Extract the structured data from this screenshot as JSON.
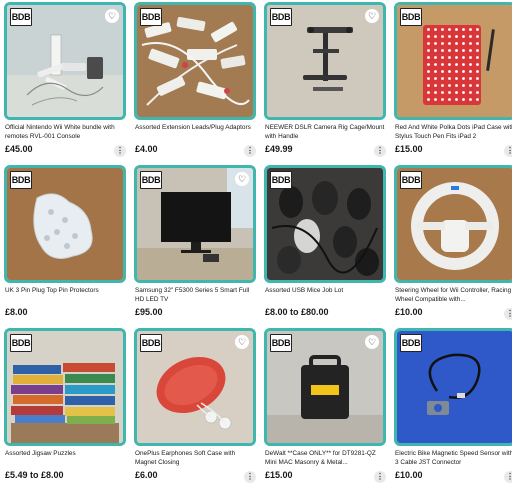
{
  "brand_badge": "BDB",
  "icons": {
    "favorite": "heart-icon",
    "more": "more-vertical-icon"
  },
  "colors": {
    "card_border": "#3fb7ae"
  },
  "listings": [
    {
      "title": "Official Nintendo Wii White bundle with remotes RVL-001 Console",
      "price": "£45.00"
    },
    {
      "title": "Assorted Extension Leads/Plug Adaptors",
      "price": "£4.00"
    },
    {
      "title": "NEEWER DSLR Camera Rig Cage/Mount with Handle",
      "price": "£49.99"
    },
    {
      "title": "Red And White Polka Dots iPad Case with Stylus Touch Pen Fits iPad 2",
      "price": "£15.00"
    },
    {
      "title": "UK 3 Pin Plug Top Pin Protectors",
      "price": "£8.00"
    },
    {
      "title": "Samsung 32\" F5300 Series 5 Smart Full HD LED TV",
      "price": "£95.00"
    },
    {
      "title": "Assorted USB Mice Job Lot",
      "price": "£8.00 to £80.00"
    },
    {
      "title": "Steering Wheel for Wii Controller, Racing Wheel Compatible with...",
      "price": "£10.00"
    },
    {
      "title": "Assorted Jigsaw Puzzles",
      "price": "£5.49 to £8.00"
    },
    {
      "title": "OnePlus Earphones Soft Case with Magnet Closing",
      "price": "£6.00"
    },
    {
      "title": "DeWalt **Case ONLY** for DT9281-QZ Mini MAC Masonry & Metal...",
      "price": "£15.00"
    },
    {
      "title": "Electric Bike Magnetic Speed Sensor with 3 Cable JST Connector",
      "price": "£10.00"
    }
  ]
}
